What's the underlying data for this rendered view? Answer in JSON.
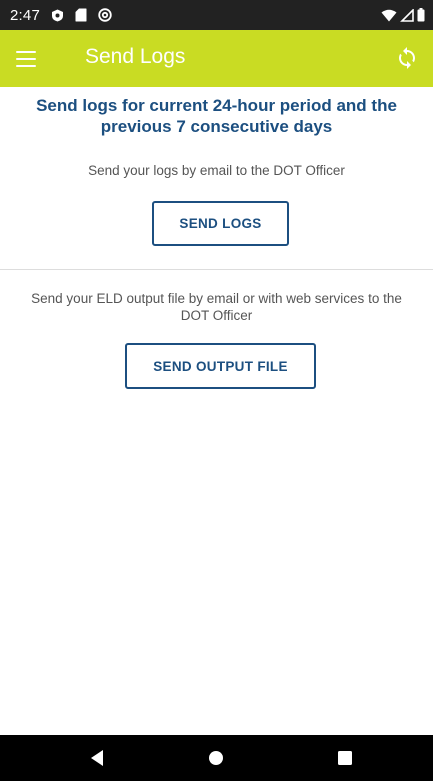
{
  "status_bar": {
    "time": "2:47",
    "icons": [
      "shield-icon",
      "sd-card-icon",
      "at-icon"
    ],
    "right_icons": [
      "wifi-icon",
      "signal-icon",
      "battery-icon"
    ]
  },
  "app_bar": {
    "title": "Send Logs",
    "background_color": "#c9dc23",
    "menu_icon": "menu-icon",
    "action_icon": "sync-icon"
  },
  "main": {
    "headline": "Send logs for current 24-hour period and the previous 7 consecutive days",
    "logs_description": "Send your logs by email to the DOT Officer",
    "send_logs_label": "SEND LOGS",
    "output_description": "Send your ELD output file by email or with web services to the DOT Officer",
    "send_output_label": "SEND OUTPUT FILE",
    "accent_color": "#1c4f80"
  },
  "nav_bar": {
    "items": [
      "back-icon",
      "home-icon",
      "recents-icon"
    ]
  }
}
